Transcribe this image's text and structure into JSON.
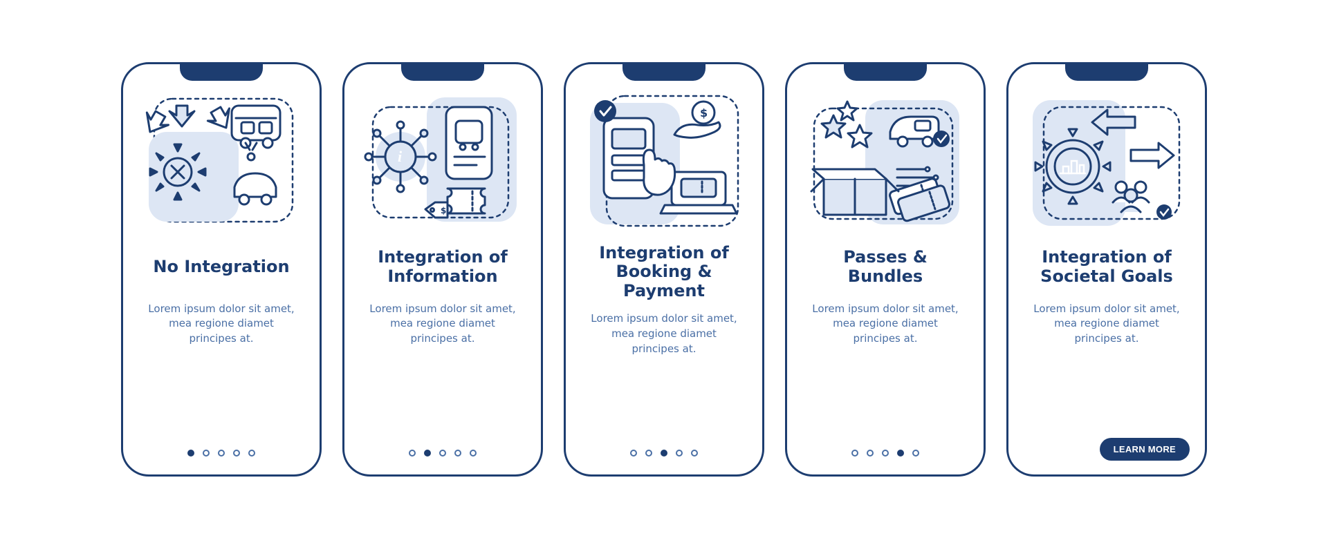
{
  "screens": [
    {
      "title": "No Integration",
      "body": "Lorem ipsum dolor sit amet, mea regione diamet principes at.",
      "activeDot": 0,
      "cta": null
    },
    {
      "title": "Integration of Information",
      "body": "Lorem ipsum dolor sit amet, mea regione diamet principes at.",
      "activeDot": 1,
      "cta": null
    },
    {
      "title": "Integration of Booking & Payment",
      "body": "Lorem ipsum dolor sit amet, mea regione diamet principes at.",
      "activeDot": 2,
      "cta": null
    },
    {
      "title": "Passes & Bundles",
      "body": "Lorem ipsum dolor sit amet, mea regione diamet principes at.",
      "activeDot": 3,
      "cta": null
    },
    {
      "title": "Integration of Societal Goals",
      "body": "Lorem ipsum dolor sit amet, mea regione diamet principes at.",
      "activeDot": null,
      "cta": "LEARN MORE"
    }
  ],
  "dotCount": 5
}
